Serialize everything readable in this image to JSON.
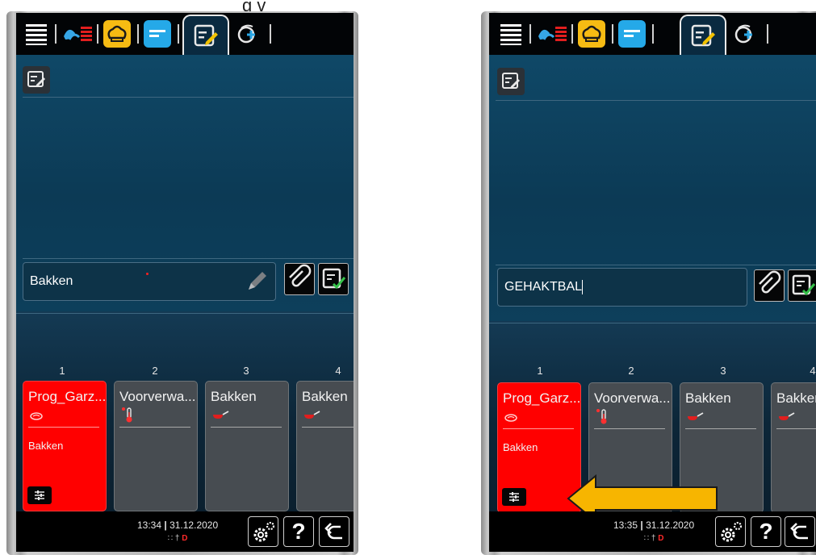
{
  "top_partial_text": "g                              v",
  "screens": [
    {
      "step_name_value": "Bakken",
      "clock_time": "13:34",
      "clock_date": "31.12.2020",
      "has_arrow": false
    },
    {
      "step_name_value": "GEHAKTBAL",
      "clock_time": "13:35",
      "clock_date": "31.12.2020",
      "has_arrow": true
    }
  ],
  "steps": [
    {
      "number": "1",
      "title": "Prog_Garz...",
      "subtitle": "Bakken",
      "icon": "food-tray-icon",
      "active": true
    },
    {
      "number": "2",
      "title": "Voorverwa...",
      "subtitle": "",
      "icon": "thermometer-icon",
      "active": false
    },
    {
      "number": "3",
      "title": "Bakken",
      "subtitle": "",
      "icon": "frying-pan-icon",
      "active": false
    },
    {
      "number": "4",
      "title": "Bakken",
      "subtitle": "",
      "icon": "frying-pan-icon",
      "active": false
    }
  ],
  "clock_separator": "|",
  "footer_buttons": [
    "settings-gears-icon",
    "help-icon",
    "back-arrow-icon"
  ],
  "help_label": "?",
  "colors": {
    "active_step": "#ff0000",
    "inactive_step": "#474c51",
    "arrow": "#f7b500",
    "screen_bg": "#0c3a55"
  }
}
